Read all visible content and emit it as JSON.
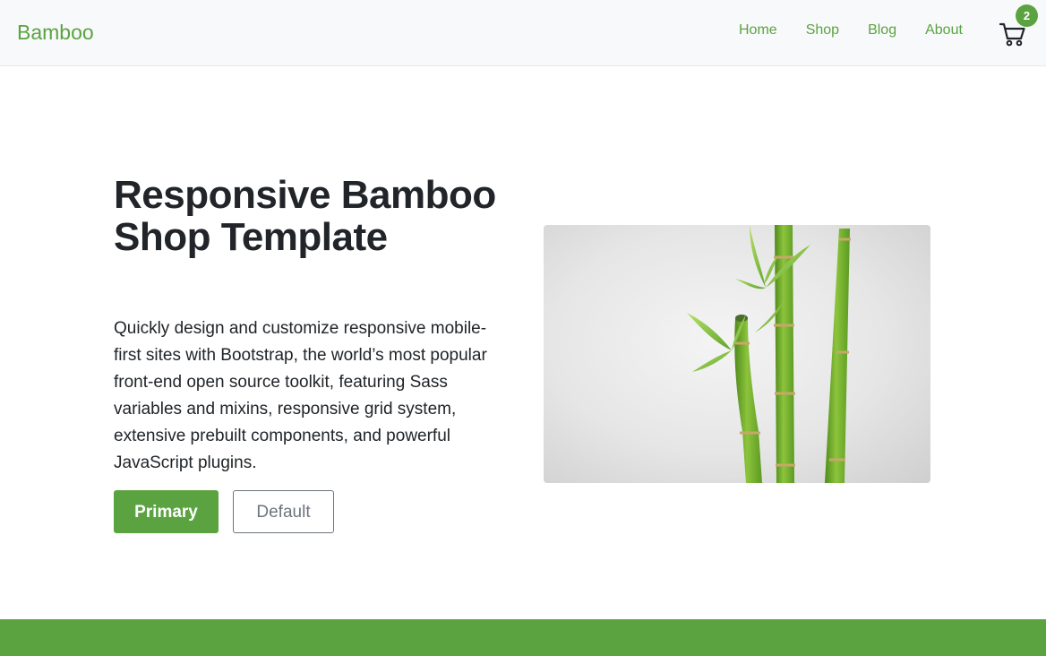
{
  "navbar": {
    "brand": "Bamboo",
    "links": [
      "Home",
      "Shop",
      "Blog",
      "About"
    ],
    "cart_count": "2",
    "cart_icon": "shopping-cart-icon"
  },
  "hero": {
    "title": "Responsive Bamboo Shop Template",
    "lead": "Quickly design and customize responsive mobile-first sites with Bootstrap, the world’s most popular front-end open source toolkit, featuring Sass variables and mixins, responsive grid system, extensive prebuilt components, and powerful JavaScript plugins.",
    "primary_label": "Primary",
    "default_label": "Default",
    "image": "bamboo-stalks-photo"
  },
  "colors": {
    "accent": "#5aa340",
    "navbar_bg": "#f8f9fa",
    "text": "#212529",
    "muted": "#6c757d"
  }
}
